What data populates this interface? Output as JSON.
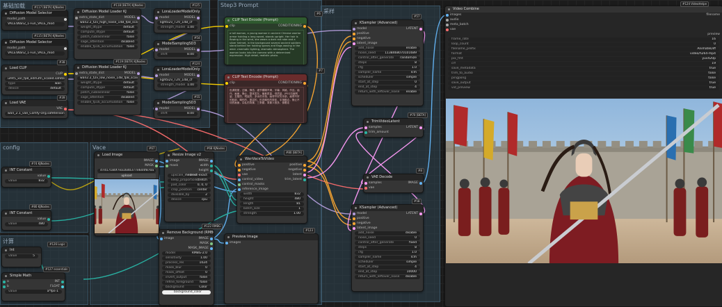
{
  "groups": {
    "left_top": "基础加载",
    "step3": "Step3 Prompt",
    "sampler": "采样",
    "config": "config",
    "vace": "Vace",
    "calc": "计算"
  },
  "nodes": {
    "dm_selector_1": {
      "title": "Diffusion Model Selector",
      "badge": "#117 [BETA] KJNodes",
      "model_path_label": "model_path",
      "model_path_value": "VACE\\Wan2_1-Fun_VACE_mod"
    },
    "dm_selector_2": {
      "title": "Diffusion Model Selector",
      "badge": "#115 [BETA] KJNodes",
      "model_path_label": "model_path",
      "model_path_value": "VACE\\Wan2_1-Fun_VACE_mod"
    },
    "dm_loader_1": {
      "title": "Diffusion Model Loader KJ",
      "badge": "#118 [BETA] KJNodes",
      "rows": [
        [
          "extra_state_dict",
          ""
        ],
        [
          "wan2.2_t2v_high_noise_14B_fp8_scale",
          ""
        ],
        [
          "weight_dtype",
          "default"
        ],
        [
          "compute_dtype",
          "default"
        ],
        [
          "patch_cublaslinear",
          "false"
        ],
        [
          "sage_attention",
          "disabled"
        ],
        [
          "enable_fp16_accumulation",
          "false"
        ]
      ]
    },
    "dm_loader_2": {
      "title": "Diffusion Model Loader KJ",
      "badge": "#119 [BETA] KJNodes",
      "rows": [
        [
          "extra_state_dict",
          ""
        ],
        [
          "wan2.2_t2v_low_noise_14B_fp8_scale",
          ""
        ],
        [
          "weight_dtype",
          "default"
        ],
        [
          "compute_dtype",
          "default"
        ],
        [
          "patch_cublaslinear",
          "false"
        ],
        [
          "sage_attention",
          "disabled"
        ],
        [
          "enable_fp16_accumulation",
          "false"
        ]
      ]
    },
    "lora_1": {
      "title": "LoraLoaderModelOnly",
      "badge": "#125",
      "model": "MODEL",
      "lora_name": "lightx2v_T2V_14B_cf",
      "strength": "1.00"
    },
    "lora_2": {
      "title": "LoraLoaderModelOnly",
      "badge": "#124",
      "model": "MODEL",
      "lora_name": "lightx2v_T2V_14B_cf",
      "strength": "1.00"
    },
    "sampling_1": {
      "title": "ModelSamplingSD3",
      "badge": "#54",
      "shift": "8.00"
    },
    "sampling_2": {
      "title": "ModelSamplingSD3",
      "badge": "#55",
      "shift": "8.00"
    },
    "load_clip": {
      "title": "Load CLIP",
      "badge": "#38",
      "clip_name": "umt5_xxl_fp8_e4m3fn_scaled.safetens",
      "type": "wan",
      "device": "default"
    },
    "load_vae": {
      "title": "Load VAE",
      "badge": "#39",
      "vae_name": "wan_2.1_vae_Comfy-Org.safetensors"
    },
    "clip_pos": {
      "title": "CLIP Text Encode (Prompt)",
      "badge": "#6",
      "text": "a tall woman, a young woman in ancient Chinese warrior armor holding a long sword, stands upright. Her hair is flowing in the wind, she wears a dark red robe and a silver helmet, in the background several ancient soldiers stand behind her holding spears and flags waving in the wind. cinematic lighting, dramatic atmosphere. The woman looks into the camera with a determined expression. High detail, realistic photo."
    },
    "clip_neg": {
      "title": "CLIP Text Encode (Prompt)",
      "badge": "#7",
      "text": "色调艳丽，过曝，静态，细节模糊不清，字幕，风格，作品，画作，画面，静止，整体发灰，最差质量，低质量，JPEG压缩残留，丑陋的，残缺的，多余的手指，画得不好的手部，画得不好的脸部，畸形的，毁容的，形态畸形的肢体，手指融合，静止不动的画面，杂乱的背景，三条腿，背景人很多，倒着走"
    },
    "ksampler_1": {
      "title": "KSampler (Advanced)",
      "badge": "#57",
      "out": "LATENT",
      "rows": [
        [
          "add_noise",
          "enable"
        ],
        [
          "noise_seed",
          "1138468070101689"
        ],
        [
          "control_after_generate",
          "randomize"
        ],
        [
          "steps",
          "8"
        ],
        [
          "cfg",
          "1.0"
        ],
        [
          "sampler_name",
          "lcm"
        ],
        [
          "scheduler",
          "simple"
        ],
        [
          "start_at_step",
          "0"
        ],
        [
          "end_at_step",
          "4"
        ],
        [
          "return_with_leftover_noise",
          "enable"
        ]
      ]
    },
    "ksampler_2": {
      "title": "KSampler (Advanced)",
      "badge": "#58",
      "out": "LATENT",
      "rows": [
        [
          "add_noise",
          "disable"
        ],
        [
          "noise_seed",
          "0"
        ],
        [
          "control_after_generate",
          "fixed"
        ],
        [
          "steps",
          "8"
        ],
        [
          "cfg",
          "1.0"
        ],
        [
          "sampler_name",
          "lcm"
        ],
        [
          "scheduler",
          "simple"
        ],
        [
          "start_at_step",
          "4"
        ],
        [
          "end_at_step",
          "10000"
        ],
        [
          "return_with_leftover_noise",
          "disable"
        ]
      ]
    },
    "trim": {
      "title": "TrimVideoLatent",
      "badge": "#70 [BETA]",
      "in": "samples",
      "out": "LATENT",
      "trim_amount": "trim_amount"
    },
    "vae_decode": {
      "title": "VAE Decode",
      "badge": "#8",
      "in1": "samples",
      "in2": "vae",
      "out": "IMAGE"
    },
    "vace": {
      "title": "WanVaceToVideo",
      "badge": "#80 [BETA]",
      "rows_in": [
        "positive",
        "negative",
        "vae",
        "control_video",
        "control_masks",
        "reference_image"
      ],
      "rows_out": [
        "positive",
        "negative",
        "latent",
        "trim_latent"
      ],
      "widgets": [
        [
          "width",
          "832"
        ],
        [
          "height",
          "480"
        ],
        [
          "length",
          "81"
        ],
        [
          "batch_size",
          "1"
        ],
        [
          "strength",
          "1.00"
        ]
      ]
    },
    "load_image": {
      "title": "Load Image",
      "badge": "#67",
      "image": "IMAGE",
      "mask": "MASK",
      "file": "d7d17180f7ea16d0377e6d4f870a",
      "upload": "upload",
      "caption": "image"
    },
    "resize": {
      "title": "Resize Image v2",
      "badge": "#68 KJNodes",
      "rows": [
        [
          "width",
          "832"
        ],
        [
          "height",
          "480"
        ],
        [
          "upscale_method",
          "nearest-exact"
        ],
        [
          "keep_proportion",
          "stretch"
        ],
        [
          "pad_color",
          "0, 0, 0"
        ],
        [
          "crop_position",
          "center"
        ],
        [
          "divisible_by",
          "2"
        ],
        [
          "device",
          "cpu"
        ]
      ]
    },
    "rembg": {
      "title": "Remove Background (RMBG)",
      "badge": "#122 RMBG",
      "rows": [
        [
          "model",
          "RMBG-2.0"
        ],
        [
          "sensitivity",
          "1.00"
        ],
        [
          "process_res",
          "1024"
        ],
        [
          "mask_blur",
          "0"
        ],
        [
          "mask_offset",
          "0"
        ],
        [
          "invert_output",
          "false"
        ],
        [
          "refine_foreground",
          "false"
        ],
        [
          "background",
          "Color"
        ]
      ],
      "bgcolor": "background_color",
      "outs": [
        "IMAGE",
        "MASK",
        "MASK_IMAGE"
      ]
    },
    "preview": {
      "title": "Preview Image",
      "badge": "#123",
      "in": "images"
    },
    "int_1": {
      "title": "INT Constant",
      "badge": "#74 KJNodes",
      "label": "value",
      "value": "832"
    },
    "int_2": {
      "title": "INT Constant",
      "badge": "#80 KJNodes",
      "label": "value",
      "value": "480"
    },
    "int_3": {
      "title": "Int",
      "badge": "#126 Logic",
      "label": "value",
      "value": "5"
    },
    "simple_math": {
      "title": "Simple Math",
      "badge": "#127 essentials",
      "value": "a*fps-1",
      "a": "a",
      "b": "b",
      "out1": "INT",
      "out2": "FLOAT"
    },
    "video_combine": {
      "title": "Video Combine",
      "badge": "#124 VideoHelpe",
      "ins": [
        "images",
        "audio",
        "meta_batch",
        "vae"
      ],
      "rows": [
        [
          "frame_rate",
          "16"
        ],
        [
          "loop_count",
          "0"
        ],
        [
          "filename_prefix",
          "AnimateDiff"
        ],
        [
          "format",
          "video/h264-mp4"
        ],
        [
          "pix_fmt",
          "yuv420p"
        ],
        [
          "crf",
          "19"
        ],
        [
          "save_metadata",
          "true"
        ],
        [
          "trim_to_audio",
          "false"
        ],
        [
          "pingpong",
          "false"
        ],
        [
          "save_output",
          "true"
        ],
        [
          "vid_preview",
          "true"
        ]
      ],
      "filename_label": "filename",
      "preview_label": "preview"
    }
  },
  "colors": {
    "model": "#b39ddb",
    "clip": "#ffd500",
    "vae": "#ff6e6e",
    "cond": "#ffa931",
    "latent": "#ff9cf9",
    "image": "#64b5f6",
    "int": "#29b6a6",
    "mask": "#81c784"
  }
}
